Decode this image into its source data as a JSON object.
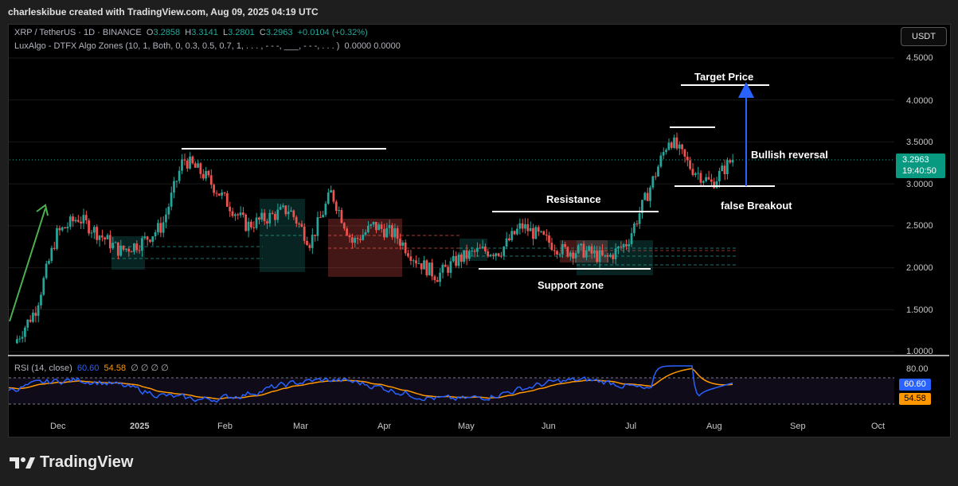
{
  "header": {
    "credit": "charleskibue created with TradingView.com, Aug 09, 2025 04:19 UTC"
  },
  "legend": {
    "symbol": "XRP / TetherUS · 1D · BINANCE",
    "o_label": "O",
    "o": "3.2858",
    "h_label": "H",
    "h": "3.3141",
    "l_label": "L",
    "l": "3.2801",
    "c_label": "C",
    "c": "3.2963",
    "change": "+0.0104 (+0.32%)",
    "indicator": "LuxAlgo - DTFX Algo Zones (10, 1, Both, 0, 0.3, 0.5, 0.7, 1, . . . , - - -, ___, - - -, . . . )",
    "indicator_values": "0.0000  0.0000"
  },
  "currency_button": "USDT",
  "y_axis": [
    "4.5000",
    "4.0000",
    "3.5000",
    "3.0000",
    "2.5000",
    "2.0000",
    "1.5000",
    "1.0000"
  ],
  "x_axis": [
    "Dec",
    "2025",
    "Feb",
    "Mar",
    "Apr",
    "May",
    "Jun",
    "Jul",
    "Aug",
    "Sep",
    "Oct"
  ],
  "last_price": {
    "price": "3.2963",
    "countdown": "19:40:50"
  },
  "annotations": {
    "target": "Target Price",
    "bullish": "Bullish reversal",
    "resistance": "Resistance",
    "support": "Support zone",
    "false_breakout": "false Breakout"
  },
  "rsi": {
    "label": "RSI (14, close)",
    "rsi_value": "60.60",
    "ma_value": "54.58",
    "extra": "∅  ∅  ∅  ∅",
    "level_label": "80.00",
    "rsi_color": "#2962ff",
    "ma_color": "#ff9800"
  },
  "footer": {
    "brand": "TradingView"
  },
  "colors": {
    "up": "#26a69a",
    "down": "#ef5350",
    "accent": "#089981",
    "arrow": "#2962ff"
  },
  "chart_data": {
    "type": "candlestick",
    "title": "XRP / TetherUS · 1D · BINANCE",
    "series": [
      {
        "name": "XRP / TetherUS",
        "x": [
          "2024-11-16",
          "2024-11-23",
          "2024-12-01",
          "2024-12-08",
          "2024-12-15",
          "2024-12-22",
          "2025-01-01",
          "2025-01-08",
          "2025-01-16",
          "2025-01-23",
          "2025-02-01",
          "2025-02-03",
          "2025-02-10",
          "2025-02-17",
          "2025-02-24",
          "2025-03-03",
          "2025-03-10",
          "2025-03-17",
          "2025-03-24",
          "2025-04-01",
          "2025-04-07",
          "2025-04-14",
          "2025-04-21",
          "2025-05-01",
          "2025-05-10",
          "2025-05-20",
          "2025-06-01",
          "2025-06-10",
          "2025-06-20",
          "2025-07-01",
          "2025-07-10",
          "2025-07-18",
          "2025-07-25",
          "2025-08-01",
          "2025-08-08"
        ],
        "values": [
          1.1,
          1.5,
          2.4,
          2.6,
          2.4,
          2.2,
          2.3,
          2.5,
          3.3,
          3.1,
          2.8,
          2.5,
          2.6,
          2.7,
          2.3,
          2.9,
          2.3,
          2.5,
          2.4,
          2.1,
          1.9,
          2.1,
          2.2,
          2.2,
          2.5,
          2.35,
          2.2,
          2.2,
          2.1,
          2.3,
          2.9,
          3.55,
          3.2,
          3.0,
          3.3
        ]
      }
    ],
    "ylim": [
      1.0,
      4.5
    ],
    "price_lines": {
      "target": 4.17,
      "high": 3.68,
      "breakout": 2.97,
      "resistance": 2.67,
      "support": 2.0,
      "previous_high": 3.42
    },
    "rsi": {
      "current": 60.6,
      "ma": 54.58,
      "levels": [
        80
      ]
    }
  }
}
